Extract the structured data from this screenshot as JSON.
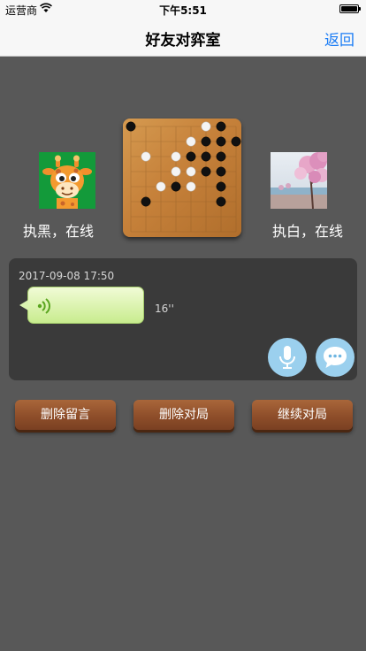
{
  "status_bar": {
    "carrier": "运营商",
    "time": "下午5:51"
  },
  "nav": {
    "title": "好友对弈室",
    "back_label": "返回"
  },
  "players": {
    "black": {
      "status": "执黑，在线"
    },
    "white": {
      "status": "执白，在线"
    }
  },
  "board": {
    "grid_size": 8,
    "stones": [
      {
        "color": "black",
        "col": 0,
        "row": 0
      },
      {
        "color": "white",
        "col": 5,
        "row": 0
      },
      {
        "color": "black",
        "col": 6,
        "row": 0
      },
      {
        "color": "white",
        "col": 4,
        "row": 1
      },
      {
        "color": "black",
        "col": 5,
        "row": 1
      },
      {
        "color": "black",
        "col": 6,
        "row": 1
      },
      {
        "color": "black",
        "col": 7,
        "row": 1
      },
      {
        "color": "white",
        "col": 1,
        "row": 2
      },
      {
        "color": "white",
        "col": 3,
        "row": 2
      },
      {
        "color": "black",
        "col": 4,
        "row": 2
      },
      {
        "color": "black",
        "col": 5,
        "row": 2
      },
      {
        "color": "black",
        "col": 6,
        "row": 2
      },
      {
        "color": "white",
        "col": 3,
        "row": 3
      },
      {
        "color": "white",
        "col": 4,
        "row": 3
      },
      {
        "color": "black",
        "col": 5,
        "row": 3
      },
      {
        "color": "black",
        "col": 6,
        "row": 3
      },
      {
        "color": "white",
        "col": 2,
        "row": 4
      },
      {
        "color": "black",
        "col": 3,
        "row": 4
      },
      {
        "color": "white",
        "col": 4,
        "row": 4
      },
      {
        "color": "black",
        "col": 6,
        "row": 4
      },
      {
        "color": "black",
        "col": 1,
        "row": 5
      },
      {
        "color": "black",
        "col": 6,
        "row": 5
      }
    ]
  },
  "message": {
    "timestamp": "2017-09-08 17:50",
    "duration": "16''"
  },
  "icons": {
    "voice": "voice-wave-icon",
    "mic": "microphone-icon",
    "chat": "chat-bubble-icon"
  },
  "colors": {
    "background": "#585858",
    "nav_accent": "#1a7cf5",
    "panel": "#3a3a3a",
    "round_button": "#9bd0ee",
    "voice_icon": "#5aa51f"
  },
  "buttons": {
    "delete_message": "删除留言",
    "delete_game": "删除对局",
    "continue_game": "继续对局"
  }
}
